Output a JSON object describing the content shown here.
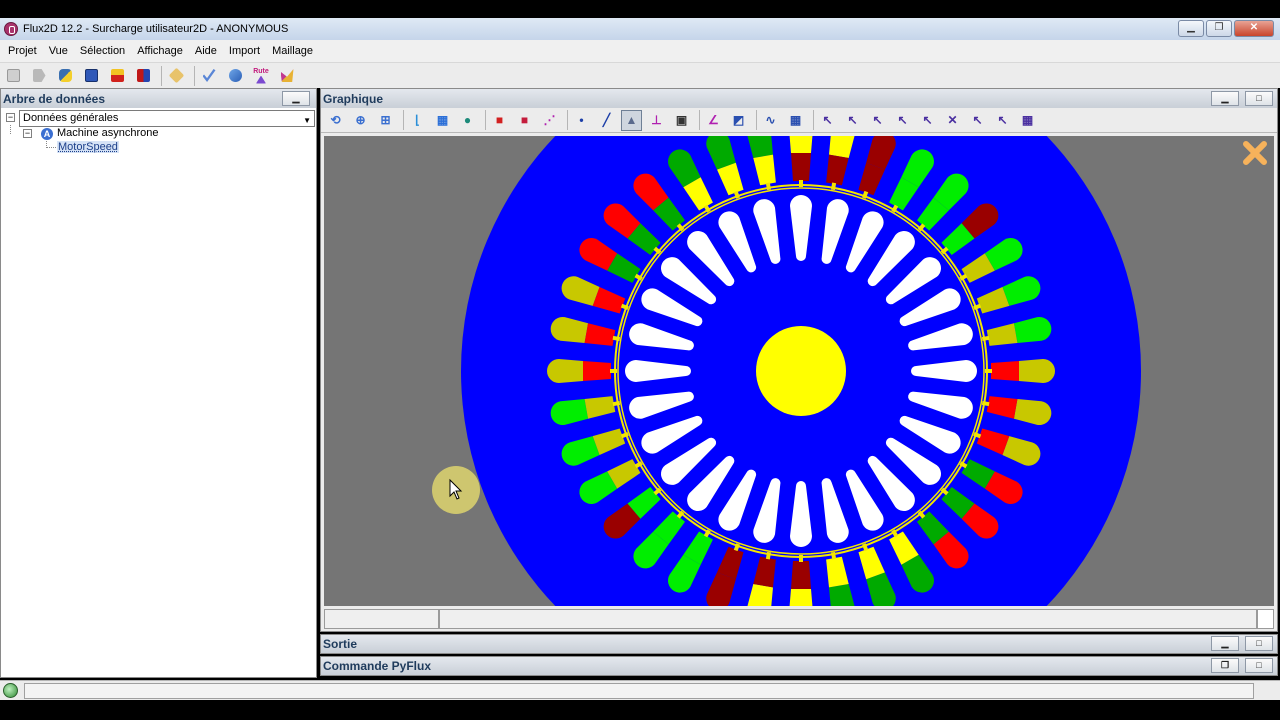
{
  "window": {
    "title": "Flux2D 12.2  - Surcharge utilisateur2D - ANONYMOUS",
    "buttons": [
      "▁",
      "❐",
      "✕"
    ]
  },
  "menu": [
    "Projet",
    "Vue",
    "Sélection",
    "Affichage",
    "Aide",
    "Import",
    "Maillage"
  ],
  "toolbar_icons": [
    "new-icon",
    "open-icon",
    "python-icon",
    "save-icon",
    "export-icon",
    "import-icon",
    "delete-icon",
    "check-icon",
    "solve-icon",
    "route-icon",
    "tools-icon"
  ],
  "toolbar_route_label": "Rute",
  "left_panel": {
    "title": "Arbre de données",
    "minimize": "▁",
    "combo_value": "Données générales",
    "tree": [
      {
        "label": "Machine asynchrone",
        "level": 1
      },
      {
        "label": "MotorSpeed",
        "level": 2,
        "selected": true
      }
    ]
  },
  "graph_panel": {
    "title": "Graphique",
    "buttons": [
      "▁",
      "□"
    ],
    "toolbar_icons": [
      "rotate-icon",
      "zoom-icon",
      "zoom-region-icon",
      "axis-icon",
      "grid-icon",
      "globe-icon",
      "face-red-icon",
      "region-red-icon",
      "xy-icon",
      "point-icon",
      "line-icon",
      "arc-icon",
      "node-icon",
      "close-line-icon",
      "edge-icon",
      "mesh-icon",
      "curve-icon",
      "table-icon",
      "select-point-icon",
      "select-line-icon",
      "select-face-icon",
      "select-region-icon",
      "select-edge-icon",
      "select-many-icon",
      "select-all-icon",
      "select-more-icon",
      "select-table-icon"
    ]
  },
  "sortie": {
    "title": "Sortie",
    "buttons": [
      "▁",
      "□"
    ]
  },
  "pyflux": {
    "title": "Commande PyFlux",
    "buttons": [
      "❐",
      "□"
    ]
  },
  "colors": {
    "stator": "#0000ff",
    "background": "#757575",
    "airgap": "#f2e600",
    "shaft": "#ffff00",
    "rotor_bar": "#ffffff",
    "phase_red": "#ff0000",
    "phase_green": "#00ee00",
    "phase_darkgreen": "#00aa00",
    "phase_yellow": "#ffff00",
    "phase_olive": "#c8c800",
    "phase_darkred": "#9a0000"
  }
}
